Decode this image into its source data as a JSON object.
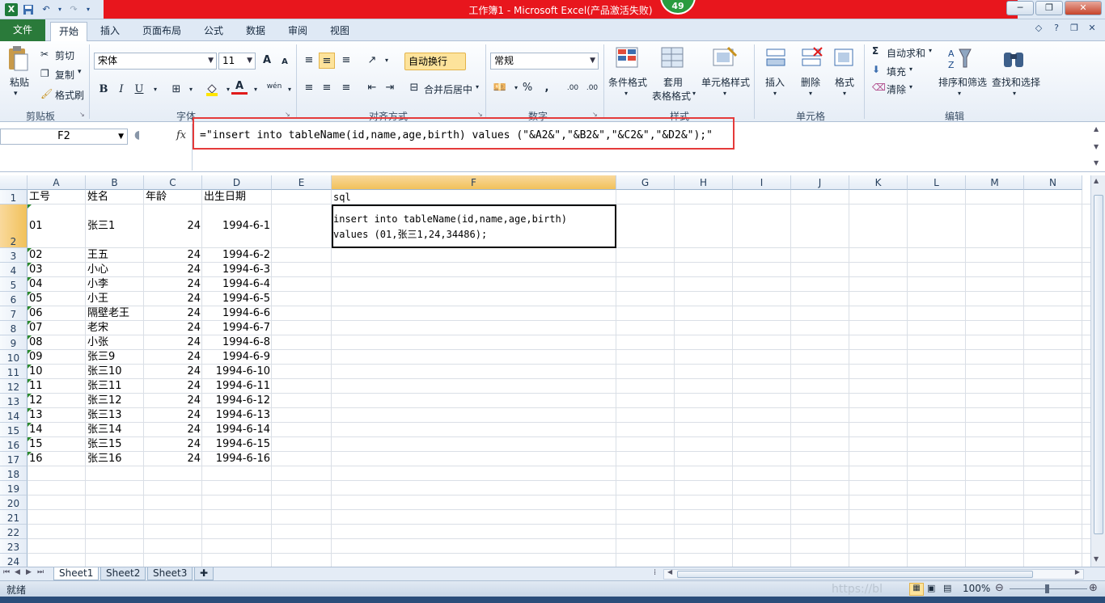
{
  "window": {
    "title": "工作簿1 - Microsoft Excel(产品激活失败)",
    "badge": "49",
    "controls": [
      "─",
      "❐",
      "✕"
    ]
  },
  "qat": {
    "logo": "X",
    "save_icon": "save-icon",
    "undo_icon": "undo-icon",
    "redo_icon": "redo-icon"
  },
  "tabs": [
    "文件",
    "开始",
    "插入",
    "页面布局",
    "公式",
    "数据",
    "审阅",
    "视图"
  ],
  "ribbon": {
    "clipboard": {
      "paste": "粘贴",
      "cut": "剪切",
      "copy": "复制",
      "format_painter": "格式刷",
      "label": "剪贴板"
    },
    "font": {
      "name": "宋体",
      "size": "11",
      "label": "字体",
      "bold": "B",
      "italic": "I",
      "underline": "U",
      "grow": "A",
      "shrink": "A",
      "font_color": "A",
      "wen": "wén"
    },
    "alignment": {
      "wrap": "自动换行",
      "merge": "合并后居中",
      "label": "对齐方式"
    },
    "number": {
      "format": "常规",
      "label": "数字",
      "percent": "%",
      "comma": ",",
      "inc": ".00",
      "dec": ".00"
    },
    "styles": {
      "conditional": "条件格式",
      "table": "套用",
      "table2": "表格格式",
      "cell_styles": "单元格样式",
      "label": "样式"
    },
    "cells": {
      "insert": "插入",
      "delete": "删除",
      "format": "格式",
      "label": "单元格"
    },
    "editing": {
      "autosum": "自动求和",
      "fill": "填充",
      "clear": "清除",
      "sort": "排序和筛选",
      "find": "查找和选择",
      "label": "编辑",
      "sigma": "Σ"
    }
  },
  "formula_bar": {
    "name_box": "F2",
    "fx": "fx",
    "formula": "=\"insert into tableName(id,name,age,birth) values (\"&A2&\",\"&B2&\",\"&C2&\",\"&D2&\");\""
  },
  "columns": [
    "A",
    "B",
    "C",
    "D",
    "E",
    "F",
    "G",
    "H",
    "I",
    "J",
    "K",
    "L",
    "M",
    "N"
  ],
  "rows": [
    "1",
    "2",
    "3",
    "4",
    "5",
    "6",
    "7",
    "8",
    "9",
    "10",
    "11",
    "12",
    "13",
    "14",
    "15",
    "16",
    "17",
    "18",
    "19",
    "20",
    "21",
    "22",
    "23",
    "24"
  ],
  "headers": {
    "a": "工号",
    "b": "姓名",
    "c": "年龄",
    "d": "出生日期",
    "f": "sql"
  },
  "table": [
    {
      "id": "01",
      "name": "张三1",
      "age": "24",
      "birth": "1994-6-1"
    },
    {
      "id": "02",
      "name": "王五",
      "age": "24",
      "birth": "1994-6-2"
    },
    {
      "id": "03",
      "name": "小心",
      "age": "24",
      "birth": "1994-6-3"
    },
    {
      "id": "04",
      "name": "小李",
      "age": "24",
      "birth": "1994-6-4"
    },
    {
      "id": "05",
      "name": "小王",
      "age": "24",
      "birth": "1994-6-5"
    },
    {
      "id": "06",
      "name": "隔壁老王",
      "age": "24",
      "birth": "1994-6-6"
    },
    {
      "id": "07",
      "name": "老宋",
      "age": "24",
      "birth": "1994-6-7"
    },
    {
      "id": "08",
      "name": "小张",
      "age": "24",
      "birth": "1994-6-8"
    },
    {
      "id": "09",
      "name": "张三9",
      "age": "24",
      "birth": "1994-6-9"
    },
    {
      "id": "10",
      "name": "张三10",
      "age": "24",
      "birth": "1994-6-10"
    },
    {
      "id": "11",
      "name": "张三11",
      "age": "24",
      "birth": "1994-6-11"
    },
    {
      "id": "12",
      "name": "张三12",
      "age": "24",
      "birth": "1994-6-12"
    },
    {
      "id": "13",
      "name": "张三13",
      "age": "24",
      "birth": "1994-6-13"
    },
    {
      "id": "14",
      "name": "张三14",
      "age": "24",
      "birth": "1994-6-14"
    },
    {
      "id": "15",
      "name": "张三15",
      "age": "24",
      "birth": "1994-6-15"
    },
    {
      "id": "16",
      "name": "张三16",
      "age": "24",
      "birth": "1994-6-16"
    }
  ],
  "sql_result": {
    "line1": "insert into tableName(id,name,age,birth)",
    "line2": "values (01,张三1,24,34486);"
  },
  "sheets": [
    "Sheet1",
    "Sheet2",
    "Sheet3"
  ],
  "status": {
    "ready": "就绪",
    "zoom": "100%",
    "watermark": "https://bl"
  }
}
